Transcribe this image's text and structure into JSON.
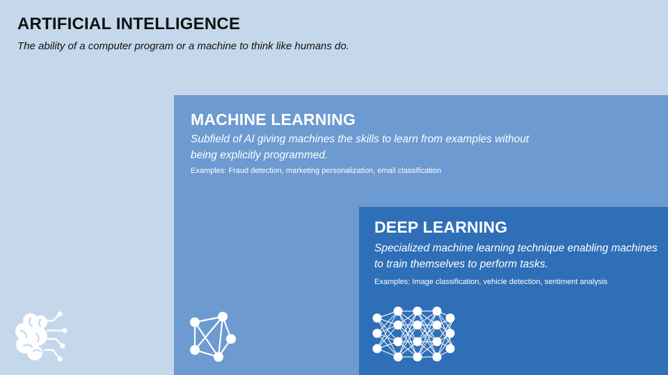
{
  "ai": {
    "title": "ARTIFICIAL INTELLIGENCE",
    "subtitle": "The ability of a computer program or a machine to think like humans do.",
    "icon": "brain-circuit-icon"
  },
  "ml": {
    "title": "MACHINE LEARNING",
    "description": "Subfield of AI giving machines the skills to learn from examples without being explicitly programmed.",
    "examples": "Examples: Fraud detection, marketing personalization, email classification",
    "icon": "network-graph-icon"
  },
  "dl": {
    "title": "DEEP LEARNING",
    "description": "Specialized machine learning technique enabling machines to train themselves to perform tasks.",
    "examples": "Examples: Image classification, vehicle detection, sentiment analysis",
    "icon": "neural-network-icon"
  },
  "colors": {
    "ai_background": "#c5d7ea",
    "ml_background": "#6d9ad0",
    "dl_background": "#2f6fb8"
  }
}
